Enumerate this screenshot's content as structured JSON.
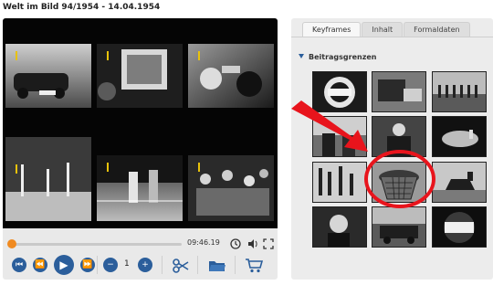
{
  "header": {
    "title": "Welt im Bild 94/1954 - 14.04.1954"
  },
  "player": {
    "time": "09:46.19",
    "progress": 0.0,
    "clip_counter": "1",
    "controls": {
      "skip_back": "⏮",
      "prev": "⏪",
      "play": "▶",
      "next": "⏩",
      "minus": "−",
      "plus": "+"
    }
  },
  "panel": {
    "tabs": [
      {
        "label": "Keyframes",
        "active": true
      },
      {
        "label": "Inhalt",
        "active": false
      },
      {
        "label": "Formaldaten",
        "active": false
      }
    ],
    "section_title": "Beitragsgrenzen"
  },
  "colors": {
    "accent": "#2b5e9b",
    "progress_knob": "#f08a20",
    "highlight": "#e8141c"
  }
}
